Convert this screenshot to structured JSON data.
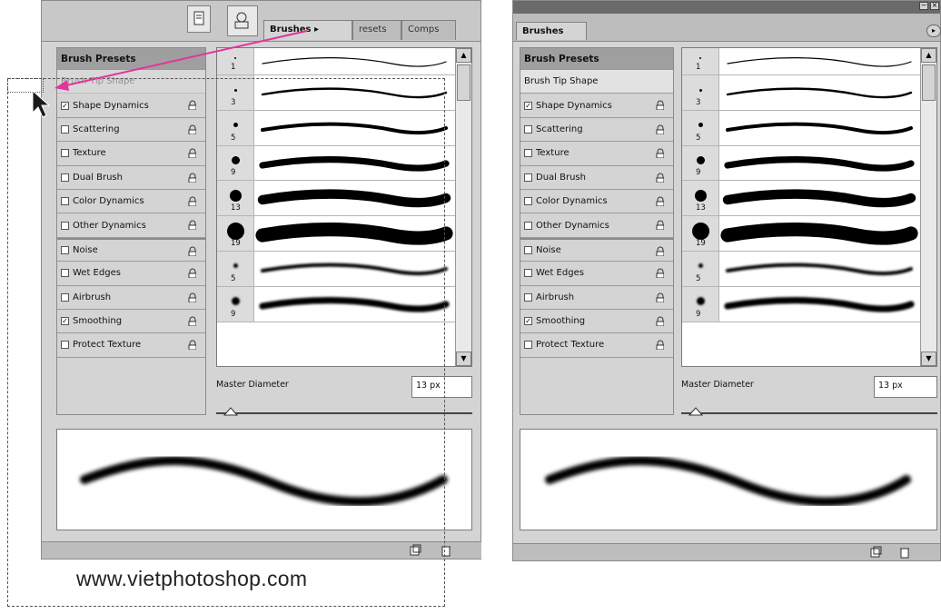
{
  "left_panel": {
    "tabs": [
      "Brushes",
      "resets",
      "Comps"
    ],
    "list_header": "Brush Presets",
    "tip_shape": "Brush Tip Shape",
    "options": [
      {
        "label": "Shape Dynamics",
        "checked": true
      },
      {
        "label": "Scattering",
        "checked": false
      },
      {
        "label": "Texture",
        "checked": false
      },
      {
        "label": "Dual Brush",
        "checked": false
      },
      {
        "label": "Color Dynamics",
        "checked": false
      },
      {
        "label": "Other Dynamics",
        "checked": false
      },
      {
        "label": "Noise",
        "checked": false
      },
      {
        "label": "Wet Edges",
        "checked": false
      },
      {
        "label": "Airbrush",
        "checked": false
      },
      {
        "label": "Smoothing",
        "checked": true
      },
      {
        "label": "Protect Texture",
        "checked": false
      }
    ],
    "brush_sizes": [
      "1",
      "3",
      "5",
      "9",
      "13",
      "19",
      "5",
      "9"
    ],
    "master_diameter_label": "Master Diameter",
    "master_diameter_value": "13 px",
    "website": "www.vietphotoshop.com"
  },
  "right_panel": {
    "tab": "Brushes",
    "list_header": "Brush Presets",
    "tip_shape": "Brush Tip Shape",
    "options": [
      {
        "label": "Shape Dynamics",
        "checked": true
      },
      {
        "label": "Scattering",
        "checked": false
      },
      {
        "label": "Texture",
        "checked": false
      },
      {
        "label": "Dual Brush",
        "checked": false
      },
      {
        "label": "Color Dynamics",
        "checked": false
      },
      {
        "label": "Other Dynamics",
        "checked": false
      },
      {
        "label": "Noise",
        "checked": false
      },
      {
        "label": "Wet Edges",
        "checked": false
      },
      {
        "label": "Airbrush",
        "checked": false
      },
      {
        "label": "Smoothing",
        "checked": true
      },
      {
        "label": "Protect Texture",
        "checked": false
      }
    ],
    "brush_sizes": [
      "1",
      "3",
      "5",
      "9",
      "13",
      "19",
      "5",
      "9"
    ],
    "master_diameter_label": "Master Diameter",
    "master_diameter_value": "13 px"
  },
  "icons": {
    "arrow_color": "#e0359a",
    "cursor": "cursor-arrow-icon",
    "lock": "lock-icon",
    "new": "new-brush-icon",
    "trash": "trash-icon"
  }
}
